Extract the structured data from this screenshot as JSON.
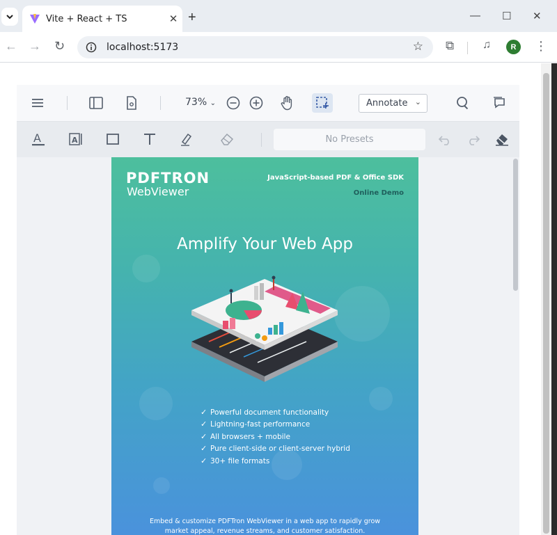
{
  "browser": {
    "tab_title": "Vite + React + TS",
    "url": "localhost:5173",
    "profile_initial": "R"
  },
  "webviewer": {
    "zoom": "73%",
    "mode_select": "Annotate",
    "presets_placeholder": "No Presets"
  },
  "document": {
    "brand": "PDFTRON",
    "brand_sub": "WebViewer",
    "tagline": "JavaScript-based PDF & Office SDK",
    "demo_label": "Online Demo",
    "headline": "Amplify Your Web App",
    "features": [
      "Powerful document functionality",
      "Lightning-fast performance",
      "All browsers + mobile",
      "Pure client-side or client-server hybrid",
      "30+ file formats"
    ],
    "footer_line1": "Embed & customize PDFTron WebViewer in a web app to rapidly grow",
    "footer_line2": "market appeal, revenue streams, and customer satisfaction."
  }
}
